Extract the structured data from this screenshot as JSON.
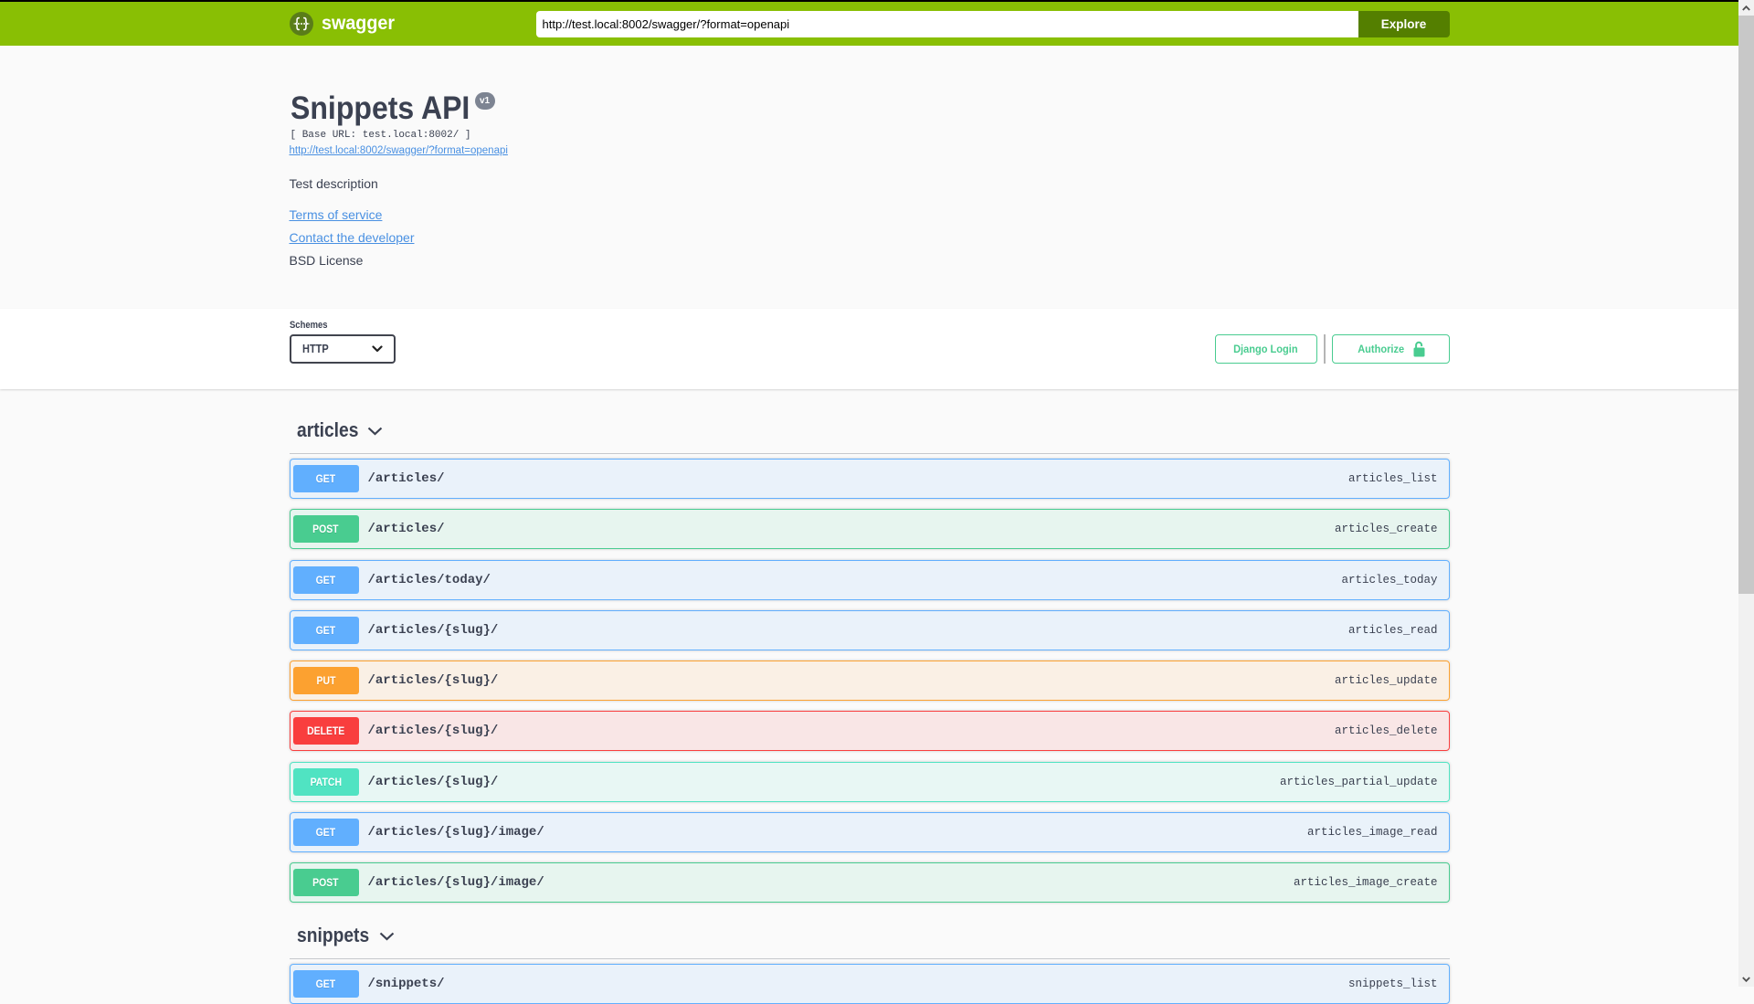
{
  "topbar": {
    "logo_icon": "swagger-braces-icon",
    "logo_text": "swagger",
    "url_input_value": "http://test.local:8002/swagger/?format=openapi",
    "explore_button_label": "Explore"
  },
  "info": {
    "title": "Snippets API",
    "version_badge": "v1",
    "base_url_text": "[ Base URL: test.local:8002/ ]",
    "spec_link_text": "http://test.local:8002/swagger/?format=openapi",
    "description": "Test description",
    "terms_link_text": "Terms of service",
    "contact_link_text": "Contact the developer",
    "license_text": "BSD License"
  },
  "schemes": {
    "label": "Schemes",
    "selected_value": "HTTP"
  },
  "auth": {
    "django_login_label": "Django Login",
    "authorize_label": "Authorize",
    "authorize_icon": "unlocked-padlock-icon"
  },
  "sections": [
    {
      "tag": "articles",
      "operations": [
        {
          "method": "GET",
          "path": "/articles/",
          "operation_id": "articles_list"
        },
        {
          "method": "POST",
          "path": "/articles/",
          "operation_id": "articles_create"
        },
        {
          "method": "GET",
          "path": "/articles/today/",
          "operation_id": "articles_today"
        },
        {
          "method": "GET",
          "path": "/articles/{slug}/",
          "operation_id": "articles_read"
        },
        {
          "method": "PUT",
          "path": "/articles/{slug}/",
          "operation_id": "articles_update"
        },
        {
          "method": "DELETE",
          "path": "/articles/{slug}/",
          "operation_id": "articles_delete"
        },
        {
          "method": "PATCH",
          "path": "/articles/{slug}/",
          "operation_id": "articles_partial_update"
        },
        {
          "method": "GET",
          "path": "/articles/{slug}/image/",
          "operation_id": "articles_image_read"
        },
        {
          "method": "POST",
          "path": "/articles/{slug}/image/",
          "operation_id": "articles_image_create"
        }
      ]
    },
    {
      "tag": "snippets",
      "operations": [
        {
          "method": "GET",
          "path": "/snippets/",
          "operation_id": "snippets_list"
        }
      ]
    }
  ],
  "colors": {
    "topbar_bg": "#89bf04",
    "explore_button_bg": "#547f00",
    "logo_circle_bg": "#5a7d19",
    "accent_green": "#49cc90",
    "link_blue": "#4990e2",
    "text_dark": "#3b4151",
    "version_badge_bg": "#7d8492",
    "methods": {
      "GET": {
        "accent": "#61affe",
        "bg": "rgba(97,175,254,0.1)"
      },
      "POST": {
        "accent": "#49cc90",
        "bg": "rgba(73,204,144,0.1)"
      },
      "PUT": {
        "accent": "#fca130",
        "bg": "rgba(252,161,48,0.1)"
      },
      "DELETE": {
        "accent": "#f93e3e",
        "bg": "rgba(249,62,62,0.1)"
      },
      "PATCH": {
        "accent": "#50e3c2",
        "bg": "rgba(80,227,194,0.1)"
      }
    }
  }
}
